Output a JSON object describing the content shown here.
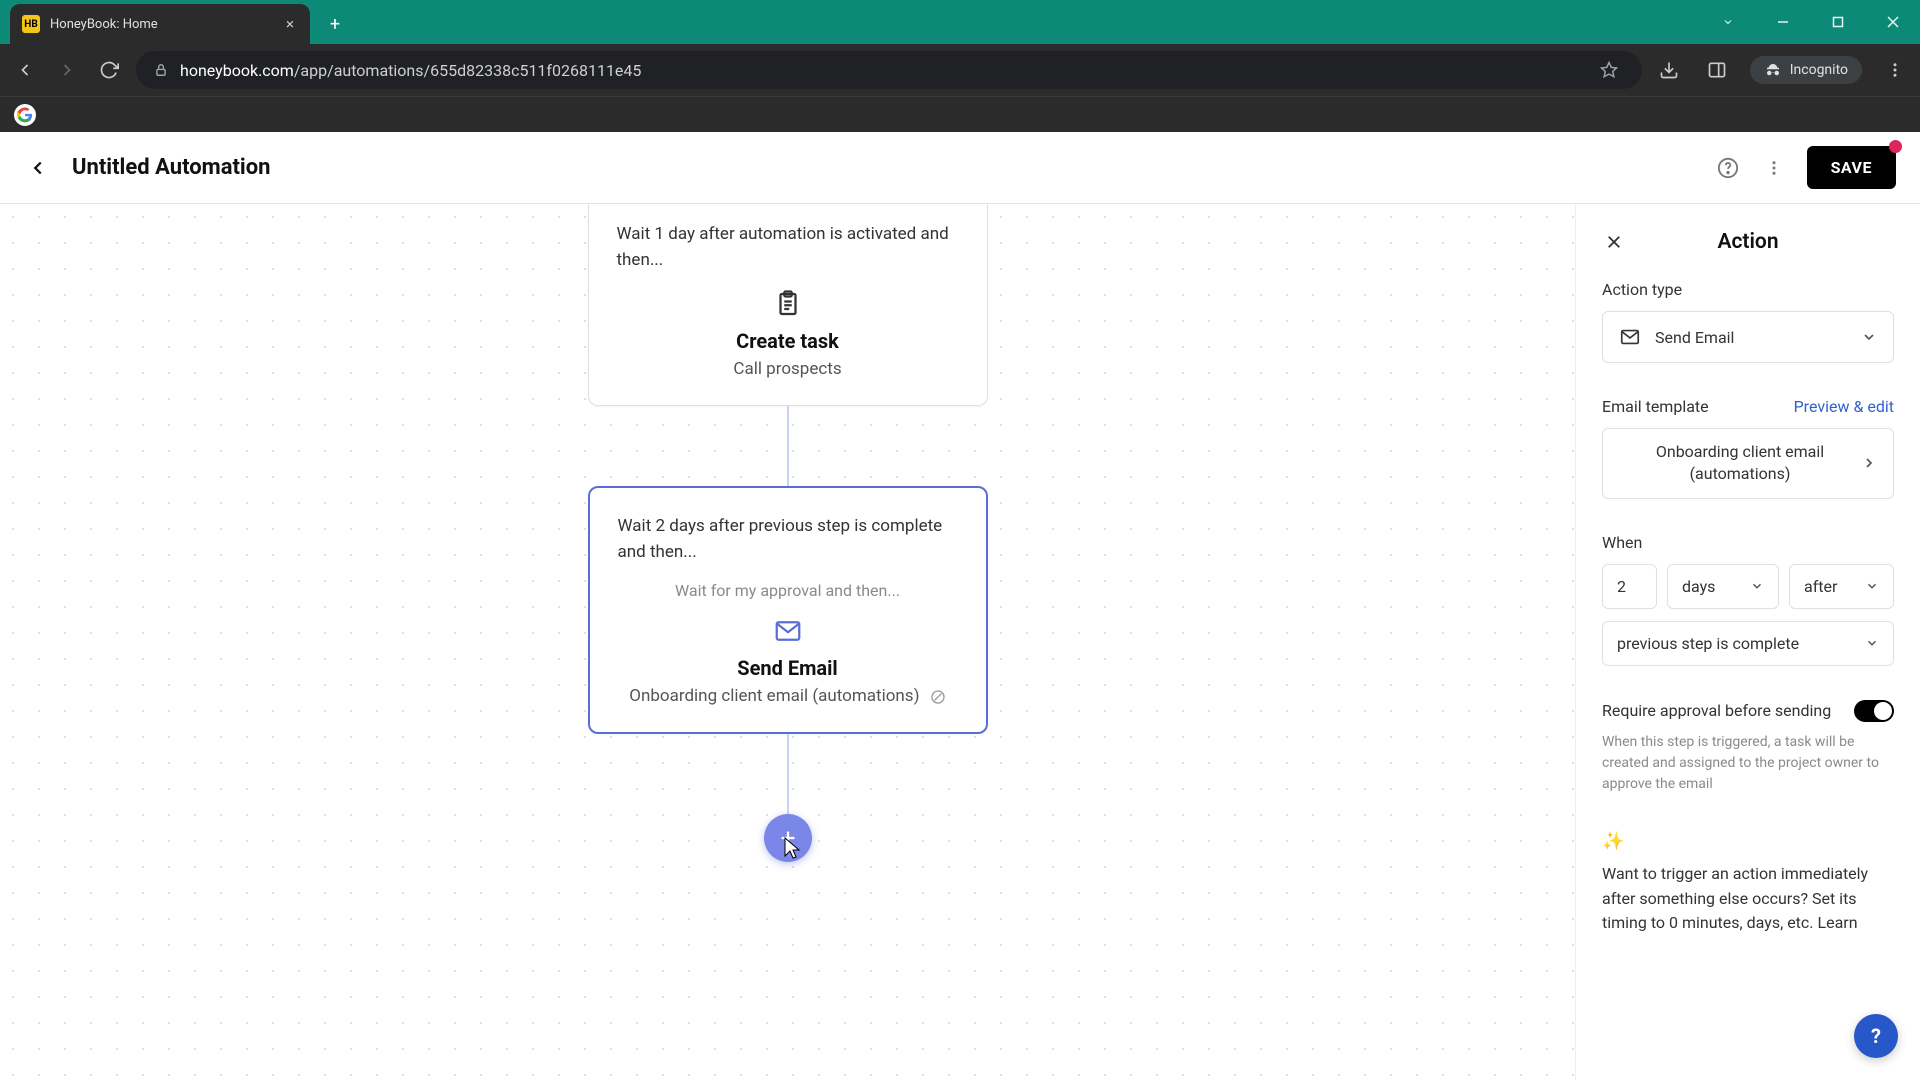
{
  "browser": {
    "tab_title": "HoneyBook: Home",
    "favicon_text": "HB",
    "url_domain": "honeybook.com",
    "url_path": "/app/automations/655d82338c511f0268111e45",
    "incognito_label": "Incognito"
  },
  "header": {
    "page_title": "Untitled Automation",
    "save_label": "SAVE"
  },
  "flow": {
    "step1": {
      "wait_text": "Wait 1 day after automation is activated and then...",
      "title": "Create task",
      "subtitle": "Call prospects"
    },
    "step2": {
      "wait_text": "Wait 2 days after previous step is complete and then...",
      "approval_text": "Wait for my approval and then...",
      "title": "Send Email",
      "subtitle": "Onboarding client email (automations)"
    }
  },
  "panel": {
    "title": "Action",
    "action_type_label": "Action type",
    "action_type_value": "Send Email",
    "email_template_label": "Email template",
    "preview_edit_label": "Preview & edit",
    "template_value": "Onboarding client email (automations)",
    "when_label": "When",
    "when_number": "2",
    "when_unit": "days",
    "when_relation": "after",
    "when_condition": "previous step is complete",
    "approval_label": "Require approval before sending",
    "approval_help": "When this step is triggered, a task will be created and assigned to the project owner to approve the email",
    "tip_text": "Want to trigger an action immediately after something else occurs? Set its timing to 0 minutes, days, etc. Learn"
  },
  "help_fab": "?"
}
